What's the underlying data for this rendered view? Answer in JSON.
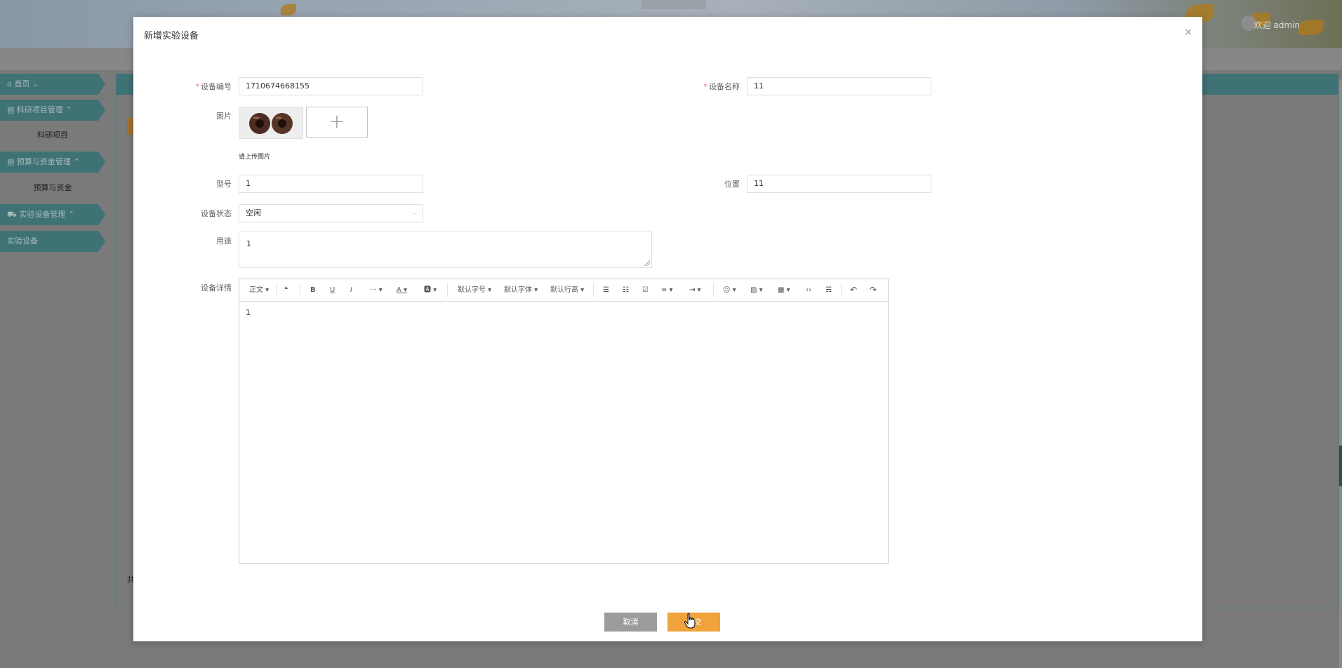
{
  "background": {
    "header_welcome": "欢迎 admin",
    "sidebar": {
      "items": [
        {
          "label": "⌂ 首页 ⌄"
        },
        {
          "label": "▤ 科研项目管理 ⌃"
        },
        {
          "label": "▤ 预算与资金管理 ⌃"
        },
        {
          "label": "⛟ 实验设备管理 ⌃"
        }
      ],
      "subitems": [
        {
          "label": "科研项目"
        },
        {
          "label": "预算与资金"
        },
        {
          "label": "实验设备"
        }
      ]
    },
    "footer_fragment": "共"
  },
  "modal": {
    "title": "新增实验设备",
    "close_glyph": "×",
    "form": {
      "device_code": {
        "label": "设备编号",
        "value": "1710674668155",
        "required": true
      },
      "device_name": {
        "label": "设备名称",
        "value": "11",
        "required": true
      },
      "image": {
        "label": "图片",
        "hint": "请上传图片",
        "add_glyph": "+"
      },
      "model": {
        "label": "型号",
        "value": "1"
      },
      "location": {
        "label": "位置",
        "value": "11"
      },
      "status": {
        "label": "设备状态",
        "value": "空闲"
      },
      "purpose": {
        "label": "用途",
        "value": "1"
      },
      "details": {
        "label": "设备详情",
        "content": "1"
      }
    },
    "editor_toolbar": [
      {
        "name": "paragraph-select",
        "label": "正文 ▾"
      },
      {
        "name": "quote-icon",
        "label": "❝"
      },
      {
        "name": "bold-icon",
        "label": "B"
      },
      {
        "name": "underline-icon",
        "label": "U"
      },
      {
        "name": "italic-icon",
        "label": "I"
      },
      {
        "name": "more-icon",
        "label": "··· ▾"
      },
      {
        "name": "font-color-icon",
        "label": "A ▾"
      },
      {
        "name": "bg-color-icon",
        "label": "🅰 ▾"
      },
      {
        "name": "font-size-select",
        "label": "默认字号 ▾"
      },
      {
        "name": "font-family-select",
        "label": "默认字体 ▾"
      },
      {
        "name": "line-height-select",
        "label": "默认行高 ▾"
      },
      {
        "name": "bulleted-list-icon",
        "label": "☰"
      },
      {
        "name": "numbered-list-icon",
        "label": "☷"
      },
      {
        "name": "todo-icon",
        "label": "☑"
      },
      {
        "name": "align-icon",
        "label": "≡ ▾"
      },
      {
        "name": "indent-icon",
        "label": "⇥ ▾"
      },
      {
        "name": "emoji-icon",
        "label": "☺ ▾"
      },
      {
        "name": "image-icon",
        "label": "▨ ▾"
      },
      {
        "name": "table-icon",
        "label": "▦ ▾"
      },
      {
        "name": "code-icon",
        "label": "‹›"
      },
      {
        "name": "divider-icon",
        "label": "☴"
      },
      {
        "name": "undo-icon",
        "label": "↶"
      },
      {
        "name": "redo-icon",
        "label": "↷"
      }
    ],
    "buttons": {
      "cancel": "取消",
      "submit": "提交"
    }
  },
  "colors": {
    "accent_submit": "#f0a33a",
    "cancel": "#9c9c9c",
    "sidebar": "#3f7275",
    "required": "#f56c6c"
  }
}
